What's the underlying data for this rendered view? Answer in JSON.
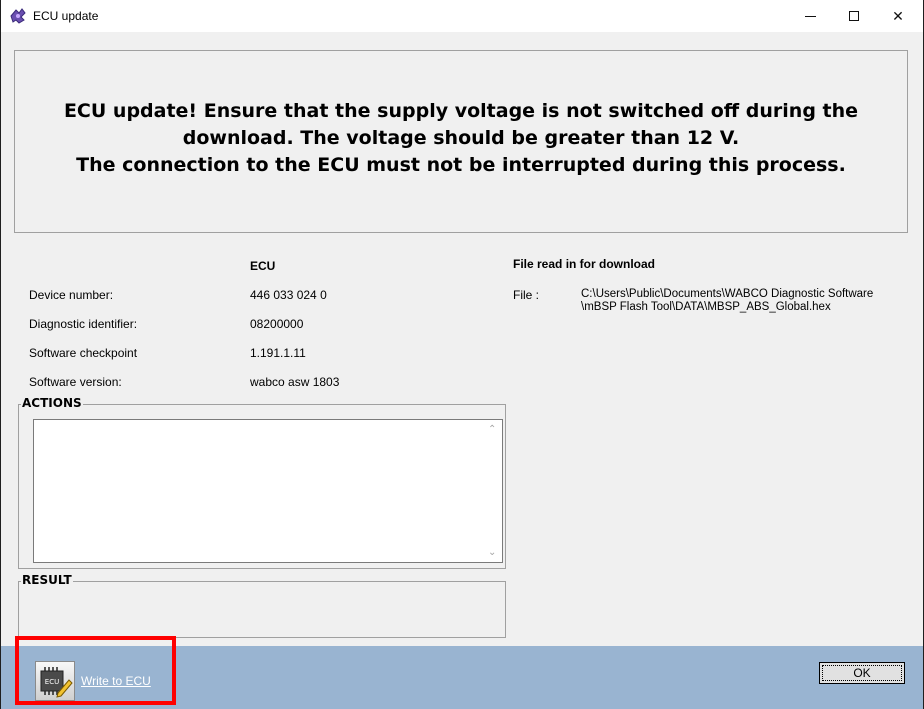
{
  "window": {
    "title": "ECU update",
    "minimize_glyph": "—",
    "close_glyph": "✕"
  },
  "banner": {
    "message": "ECU update! Ensure that the supply voltage is not switched off during the\ndownload. The voltage should be greater than 12 V.\nThe connection to the ECU must not be interrupted during this process."
  },
  "ecu": {
    "column_header": "ECU",
    "rows": [
      {
        "label": "Device number:",
        "value": "446 033 024 0"
      },
      {
        "label": "Diagnostic identifier:",
        "value": "08200000"
      },
      {
        "label": "Software checkpoint",
        "value": "1.191.1.11"
      },
      {
        "label": "Software version:",
        "value": "wabco asw 1803"
      }
    ]
  },
  "file": {
    "header": "File read in for download",
    "label": "File :",
    "path_line1": "C:\\Users\\Public\\Documents\\WABCO Diagnostic Software",
    "path_line2": "\\mBSP Flash Tool\\DATA\\MBSP_ABS_Global.hex"
  },
  "actions": {
    "title": "ACTIONS",
    "content": ""
  },
  "result": {
    "title": "RESULT"
  },
  "footer": {
    "write_label": "Write to ECU",
    "ok_label": "OK"
  },
  "icons": {
    "app": "ecu-puzzle-icon",
    "write": "ecu-chip-pencil-icon"
  },
  "colors": {
    "footer_bg": "#99b4d1",
    "highlight": "#ff0000"
  }
}
